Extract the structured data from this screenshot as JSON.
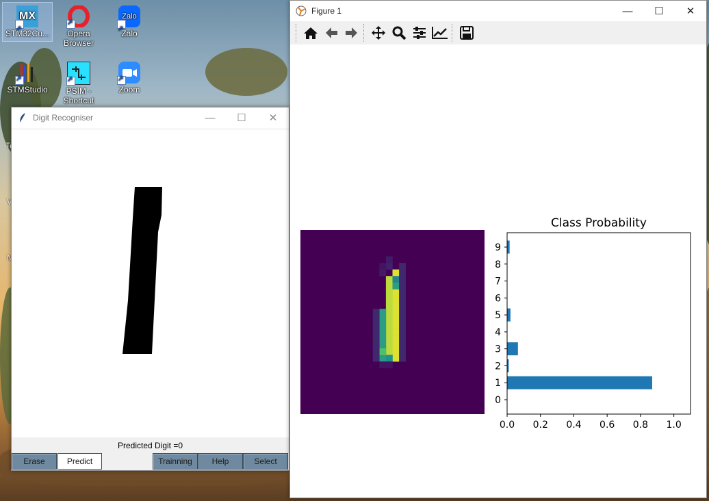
{
  "desktop": {
    "icons": [
      {
        "label": "STM32Cu...",
        "icon": "stm32cubemx-icon"
      },
      {
        "label": "Opera\nBrowser",
        "icon": "opera-browser-icon"
      },
      {
        "label": "Zalo",
        "icon": "zalo-icon"
      },
      {
        "label": "STMStudio",
        "icon": "stmstudio-icon"
      },
      {
        "label": "PSIM -\nShortcut",
        "icon": "psim-icon"
      },
      {
        "label": "Zoom",
        "icon": "zoom-icon"
      }
    ],
    "edge_letters": [
      "Te",
      "V",
      "N"
    ],
    "zalo_text": "Zalo",
    "mx_text": "MX"
  },
  "digit_window": {
    "title": "Digit Recogniser",
    "status": "Predicted Digit =0",
    "buttons": {
      "erase": "Erase",
      "predict": "Predict",
      "training": "Trainning",
      "help": "Help",
      "select": "Select"
    }
  },
  "figure_window": {
    "title": "Figure 1",
    "toolbar": [
      "home-icon",
      "back-icon",
      "forward-icon",
      "pan-icon",
      "zoom-icon",
      "configure-subplots-icon",
      "edit-axis-icon",
      "save-icon"
    ]
  },
  "chart_data": {
    "type": "bar",
    "orientation": "horizontal",
    "title": "Class Probability",
    "categories": [
      "0",
      "1",
      "2",
      "3",
      "4",
      "5",
      "6",
      "7",
      "8",
      "9"
    ],
    "values": [
      0.0,
      0.87,
      0.01,
      0.065,
      0.0,
      0.02,
      0.0,
      0.0,
      0.0,
      0.015
    ],
    "xlim": [
      0,
      1.1
    ],
    "xticks": [
      "0.0",
      "0.2",
      "0.4",
      "0.6",
      "0.8",
      "1.0"
    ],
    "bar_color": "#1f77b4"
  },
  "heatmap": {
    "background": "#440154",
    "colormap": "viridis"
  }
}
